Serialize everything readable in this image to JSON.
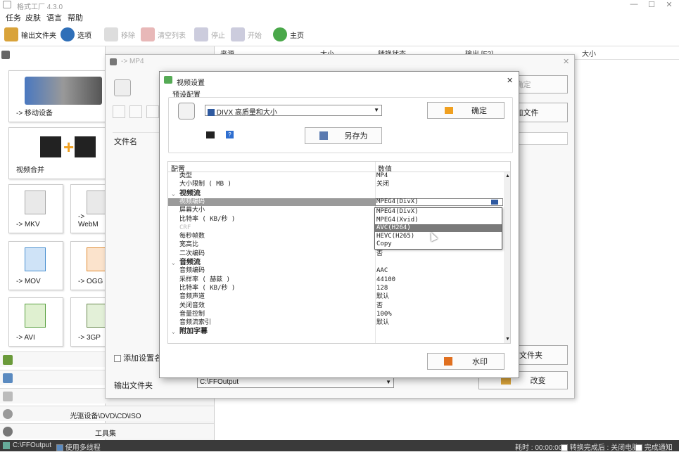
{
  "app": {
    "title": "格式工厂 4.3.0"
  },
  "menu": [
    "任务",
    "皮肤",
    "语言",
    "帮助"
  ],
  "toolbar": {
    "output_folder": "输出文件夹",
    "options": "选项",
    "remove": "移除",
    "clear_list": "清空列表",
    "stop": "停止",
    "start": "开始",
    "home": "主页"
  },
  "left_panel": {
    "tiles": [
      {
        "label": "-> 移动设备"
      },
      {
        "label": "视频合并"
      },
      {
        "label": "-> MKV"
      },
      {
        "label": "-> WebM"
      },
      {
        "label": "-> MOV"
      },
      {
        "label": "-> OGG"
      },
      {
        "label": "-> AVI"
      },
      {
        "label": "-> 3GP"
      }
    ],
    "categories": [
      "光驱设备\\DVD\\CD\\ISO",
      "工具集"
    ]
  },
  "filelist": {
    "columns": [
      "来源",
      "大小",
      "转换状态",
      "输出 [F2]",
      "大小"
    ]
  },
  "mp4_window": {
    "title": "-> MP4",
    "filename_label": "文件名",
    "ok_button": "确定",
    "add_file_button": "添加文件",
    "add_folder_button": "添加文件夹",
    "add_setting_label": "添加设置名称",
    "output_folder_label": "输出文件夹",
    "output_folder_value": "C:\\FFOutput",
    "change_button": "改变"
  },
  "video_settings": {
    "title": "视频设置",
    "preset_group": "预设配置",
    "preset_value": "DIVX 高质量和大小",
    "ok_button": "确定",
    "save_as_button": "另存为",
    "watermark_button": "水印",
    "table_header": {
      "config": "配置",
      "value": "数值"
    },
    "rows": [
      {
        "k": "类型",
        "v": "MP4"
      },
      {
        "k": "大小限制 ( MB )",
        "v": "关闭"
      },
      {
        "k": "视频流",
        "v": "",
        "group": true
      },
      {
        "k": "视频编码",
        "v": "MPEG4(DivX)",
        "selected": true
      },
      {
        "k": "屏幕大小",
        "v": ""
      },
      {
        "k": "比特率 ( KB/秒 )",
        "v": ""
      },
      {
        "k": "CRF",
        "v": "",
        "dim": true
      },
      {
        "k": "每秒帧数",
        "v": ""
      },
      {
        "k": "宽高比",
        "v": ""
      },
      {
        "k": "二次编码",
        "v": "否"
      },
      {
        "k": "音频流",
        "v": "",
        "group": true
      },
      {
        "k": "音频编码",
        "v": "AAC"
      },
      {
        "k": "采样率 ( 赫兹 )",
        "v": "44100"
      },
      {
        "k": "比特率 ( KB/秒 )",
        "v": "128"
      },
      {
        "k": "音频声道",
        "v": "默认"
      },
      {
        "k": "关闭音效",
        "v": "否"
      },
      {
        "k": "音量控制",
        "v": "100%"
      },
      {
        "k": "音频流索引",
        "v": "默认"
      },
      {
        "k": "附加字幕",
        "v": "",
        "group": true
      }
    ],
    "codec_options": [
      "MPEG4(DivX)",
      "MPEG4(Xvid)",
      "AVC(H264)",
      "HEVC(H265)",
      "Copy"
    ],
    "highlighted_option": "AVC(H264)"
  },
  "statusbar": {
    "output_path": "C:\\FFOutput",
    "multithread": "使用多线程",
    "elapsed": "耗时 : 00:00:00",
    "after_convert": "转换完成后 : 关闭电脑",
    "notify": "完成通知"
  },
  "colors": {
    "accent_selected": "#9a9a9a",
    "statusbar": "#3a3a3a"
  }
}
